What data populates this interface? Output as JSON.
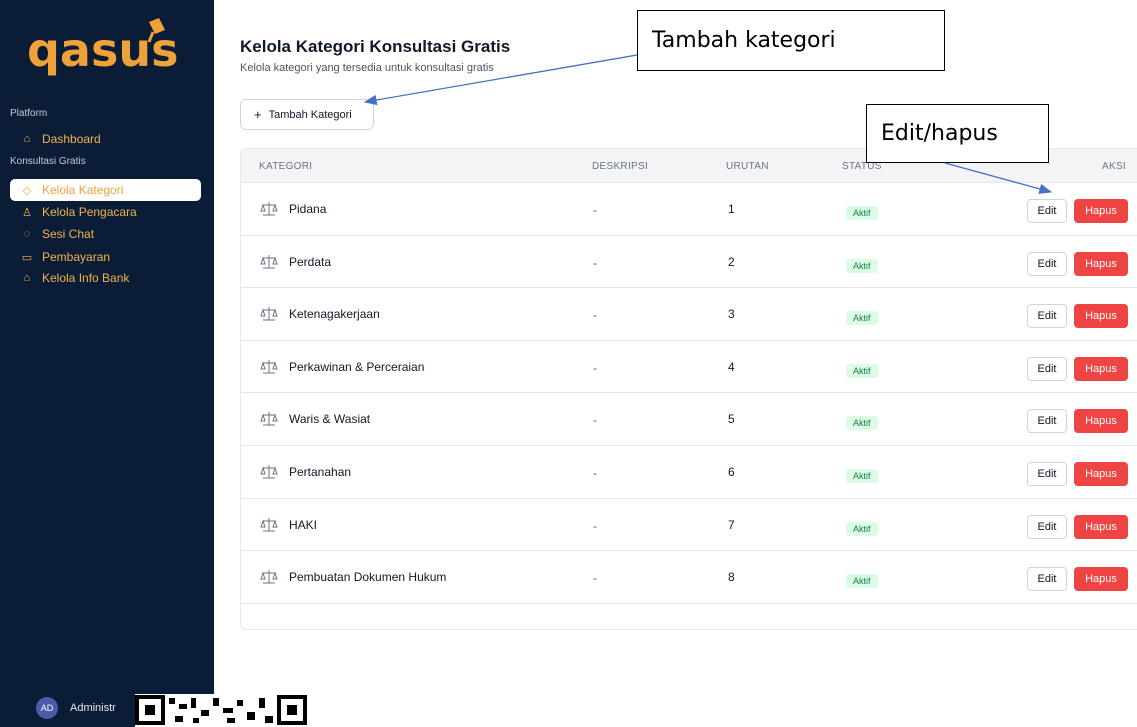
{
  "brand": {
    "logo_text": "qasus"
  },
  "sidebar": {
    "sections": [
      {
        "label": "Platform"
      },
      {
        "label": "Konsultasi Gratis"
      }
    ],
    "items": [
      {
        "label": "Dashboard",
        "icon": "home-icon"
      },
      {
        "label": "Kelola Kategori",
        "icon": "tag-icon",
        "active": true
      },
      {
        "label": "Kelola Pengacara",
        "icon": "users-icon"
      },
      {
        "label": "Sesi Chat",
        "icon": "chat-icon"
      },
      {
        "label": "Pembayaran",
        "icon": "card-icon"
      },
      {
        "label": "Kelola Info Bank",
        "icon": "bank-icon"
      }
    ],
    "user": {
      "initials": "AD",
      "name": "Administr"
    }
  },
  "header": {
    "title": "Kelola Kategori Konsultasi Gratis",
    "subtitle": "Kelola kategori yang tersedia untuk konsultasi gratis",
    "add_button": "Tambah Kategori"
  },
  "table": {
    "columns": [
      "KATEGORI",
      "DESKRIPSI",
      "URUTAN",
      "STATUS",
      "AKSI"
    ],
    "rows": [
      {
        "name": "Pidana",
        "desc": "-",
        "order": "1",
        "status": "Aktif"
      },
      {
        "name": "Perdata",
        "desc": "-",
        "order": "2",
        "status": "Aktif"
      },
      {
        "name": "Ketenagakerjaan",
        "desc": "-",
        "order": "3",
        "status": "Aktif"
      },
      {
        "name": "Perkawinan & Perceraian",
        "desc": "-",
        "order": "4",
        "status": "Aktif"
      },
      {
        "name": "Waris & Wasiat",
        "desc": "-",
        "order": "5",
        "status": "Aktif"
      },
      {
        "name": "Pertanahan",
        "desc": "-",
        "order": "6",
        "status": "Aktif"
      },
      {
        "name": "HAKI",
        "desc": "-",
        "order": "7",
        "status": "Aktif"
      },
      {
        "name": "Pembuatan Dokumen Hukum",
        "desc": "-",
        "order": "8",
        "status": "Aktif"
      }
    ],
    "edit_label": "Edit",
    "delete_label": "Hapus"
  },
  "annotations": {
    "add_callout": "Tambah kategori",
    "edit_callout": "Edit/hapus"
  },
  "colors": {
    "sidebar_bg": "#0b1d36",
    "accent": "#f0b44a",
    "danger": "#ef4444",
    "success_bg": "#dcfce7",
    "success_text": "#15803d"
  }
}
